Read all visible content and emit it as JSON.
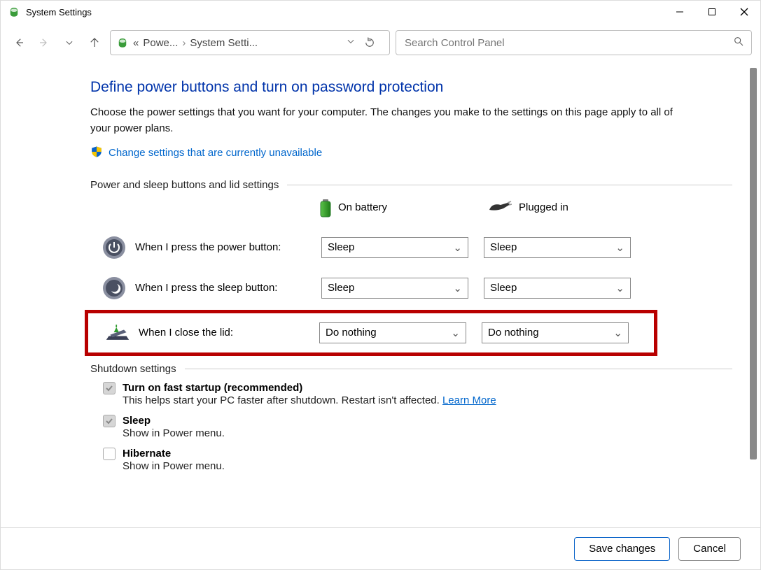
{
  "window": {
    "title": "System Settings"
  },
  "breadcrumb": {
    "prefix": "«",
    "part1": "Powe...",
    "part2": "System Setti..."
  },
  "search": {
    "placeholder": "Search Control Panel"
  },
  "page": {
    "heading": "Define power buttons and turn on password protection",
    "intro": "Choose the power settings that you want for your computer. The changes you make to the settings on this page apply to all of your power plans.",
    "change_link": "Change settings that are currently unavailable"
  },
  "sections": {
    "power_sleep": "Power and sleep buttons and lid settings",
    "shutdown": "Shutdown settings"
  },
  "columns": {
    "battery": "On battery",
    "plugged": "Plugged in"
  },
  "rows": {
    "power_button": {
      "label": "When I press the power button:",
      "battery": "Sleep",
      "plugged": "Sleep"
    },
    "sleep_button": {
      "label": "When I press the sleep button:",
      "battery": "Sleep",
      "plugged": "Sleep"
    },
    "close_lid": {
      "label": "When I close the lid:",
      "battery": "Do nothing",
      "plugged": "Do nothing"
    }
  },
  "shutdown": {
    "fast_startup": {
      "title": "Turn on fast startup (recommended)",
      "desc_pre": "This helps start your PC faster after shutdown. Restart isn't affected. ",
      "learn_more": "Learn More",
      "checked": true
    },
    "sleep": {
      "title": "Sleep",
      "desc": "Show in Power menu.",
      "checked": true
    },
    "hibernate": {
      "title": "Hibernate",
      "desc": "Show in Power menu.",
      "checked": false
    }
  },
  "footer": {
    "save": "Save changes",
    "cancel": "Cancel"
  }
}
